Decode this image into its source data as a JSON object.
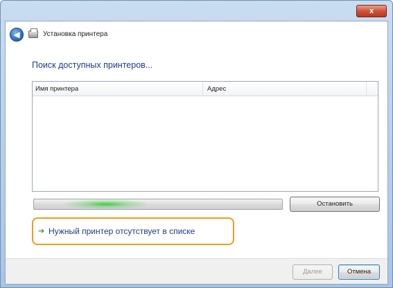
{
  "window": {
    "title": "Установка принтера",
    "close_label": "x"
  },
  "header": {
    "back_glyph": "◀"
  },
  "main": {
    "heading": "Поиск доступных принтеров...",
    "list": {
      "columns": [
        "Имя принтера",
        "Адрес"
      ],
      "rows": []
    },
    "progress_state": "in-progress",
    "stop_label": "Остановить",
    "missing_printer_link": "Нужный принтер отсутствует в списке"
  },
  "footer": {
    "next_label": "Далее",
    "cancel_label": "Отмена"
  },
  "colors": {
    "heading": "#1e3a8c",
    "highlight": "#f39a1f",
    "arrow": "#2f9e3f"
  },
  "icons": {
    "back": "back-arrow-icon",
    "app": "printer-icon",
    "link_arrow": "green-arrow-icon",
    "close": "close-icon"
  }
}
